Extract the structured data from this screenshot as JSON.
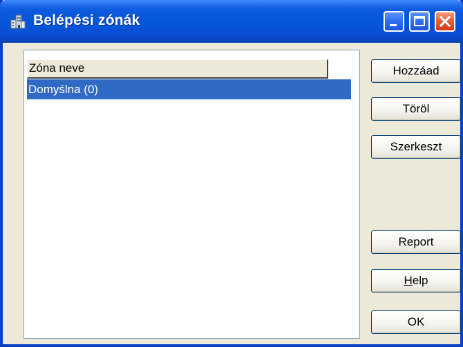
{
  "window": {
    "title": "Belépési zónák",
    "icon": "zone-building-icon"
  },
  "titlebar_buttons": [
    "minimize-icon",
    "maximize-icon",
    "close-icon"
  ],
  "list": {
    "column_header": "Zóna neve",
    "rows": [
      "Domyślna (0)"
    ],
    "selected_row": 0
  },
  "buttons": {
    "add": "Hozzáad",
    "delete": "Töröl",
    "edit": "Szerkeszt",
    "report": "Report",
    "help_underlined": "H",
    "help_rest": "elp",
    "ok": "OK"
  },
  "colors": {
    "titlebar": "#0556d8",
    "selection": "#316ac5",
    "dialog_bg": "#ece9d8"
  }
}
